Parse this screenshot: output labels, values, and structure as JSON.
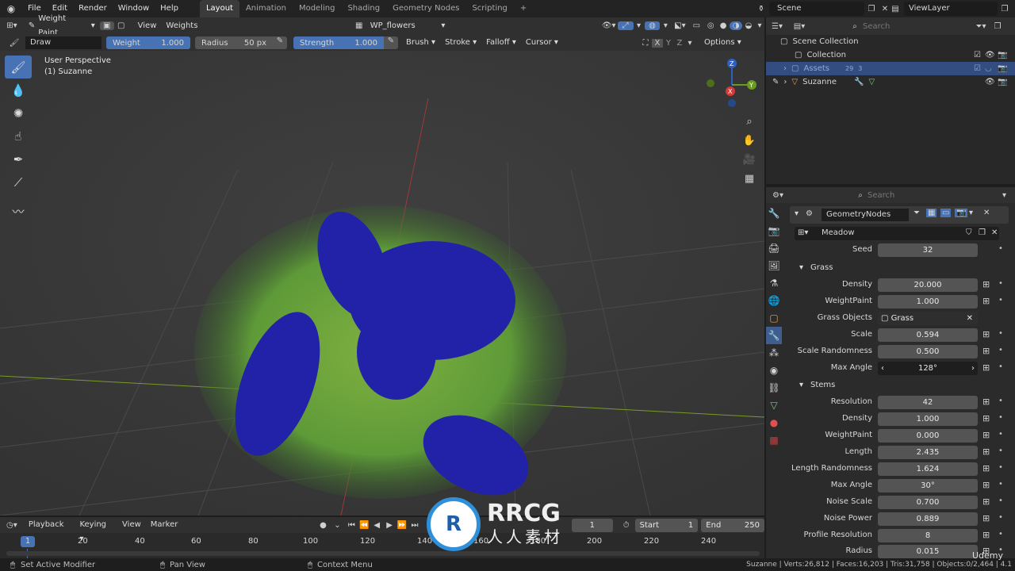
{
  "topbar": {
    "menus": [
      "File",
      "Edit",
      "Render",
      "Window",
      "Help"
    ],
    "tabs": [
      "Layout",
      "Animation",
      "Modeling",
      "Shading",
      "Geometry Nodes",
      "Scripting"
    ],
    "active_tab": "Layout",
    "scene": "Scene",
    "view_layer": "ViewLayer"
  },
  "header": {
    "mode": "Weight Paint",
    "view": "View",
    "weights": "Weights",
    "attribute": "WP_flowers"
  },
  "tool_settings": {
    "brush_name": "Draw",
    "weight_label": "Weight",
    "weight_value": "1.000",
    "radius_label": "Radius",
    "radius_value": "50 px",
    "strength_label": "Strength",
    "strength_value": "1.000",
    "menus": [
      "Brush",
      "Stroke",
      "Falloff",
      "Cursor"
    ],
    "axes": [
      "X",
      "Y",
      "Z"
    ],
    "options": "Options"
  },
  "viewport": {
    "perspective": "User Perspective",
    "object": "(1) Suzanne",
    "gizmo_axes": [
      "Z",
      "Y",
      "X"
    ]
  },
  "outliner": {
    "search_placeholder": "Search",
    "scene_collection": "Scene Collection",
    "items": [
      {
        "name": "Collection"
      },
      {
        "name": "Assets",
        "badge1": "29",
        "badge2": "3"
      },
      {
        "name": "Suzanne"
      }
    ]
  },
  "properties": {
    "search_placeholder": "Search",
    "modifier_name": "GeometryNodes",
    "node_group": "Meadow",
    "seed": {
      "label": "Seed",
      "value": "32"
    },
    "grass_section": "Grass",
    "grass": [
      {
        "label": "Density",
        "value": "20.000"
      },
      {
        "label": "WeightPaint",
        "value": "1.000"
      },
      {
        "label": "Grass Objects",
        "value": "Grass"
      },
      {
        "label": "Scale",
        "value": "0.594"
      },
      {
        "label": "Scale Randomness",
        "value": "0.500"
      },
      {
        "label": "Max Angle",
        "value": "128°"
      }
    ],
    "stems_section": "Stems",
    "stems": [
      {
        "label": "Resolution",
        "value": "42"
      },
      {
        "label": "Density",
        "value": "1.000"
      },
      {
        "label": "WeightPaint",
        "value": "0.000"
      },
      {
        "label": "Length",
        "value": "2.435"
      },
      {
        "label": "Length Randomness",
        "value": "1.624"
      },
      {
        "label": "Max Angle",
        "value": "30°"
      },
      {
        "label": "Noise Scale",
        "value": "0.700"
      },
      {
        "label": "Noise Power",
        "value": "0.889"
      },
      {
        "label": "Profile Resolution",
        "value": "8"
      },
      {
        "label": "Radius",
        "value": "0.015"
      }
    ]
  },
  "timeline": {
    "menus": [
      "Playback",
      "Keying",
      "View",
      "Marker"
    ],
    "current_frame": "1",
    "start_label": "Start",
    "start_value": "1",
    "end_label": "End",
    "end_value": "250",
    "ticks": [
      "20",
      "40",
      "60",
      "80",
      "100",
      "120",
      "140",
      "160",
      "180",
      "200",
      "220",
      "240"
    ],
    "playhead": "1"
  },
  "statusbar": {
    "left": "Set Active Modifier",
    "mid": "Pan View",
    "context": "Context Menu",
    "stats": "Suzanne | Verts:26,812 | Faces:16,203 | Tris:31,758 | Objects:0/2,464 | 4.1"
  },
  "watermark": {
    "brand": "RRCG",
    "sub": "人人素材",
    "udemy": "Udemy"
  }
}
